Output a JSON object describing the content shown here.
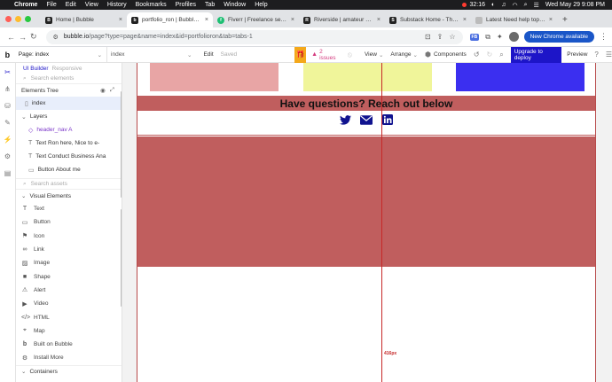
{
  "menubar": {
    "app": "Chrome",
    "items": [
      "File",
      "Edit",
      "View",
      "History",
      "Bookmarks",
      "Profiles",
      "Tab",
      "Window",
      "Help"
    ],
    "timer": "32:16",
    "datetime": "Wed May 29  9:08 PM"
  },
  "tabs": [
    {
      "title": "Home | Bubble",
      "favicon": "B",
      "color": "#222"
    },
    {
      "title": "portfolio_ron | Bubble Editor",
      "favicon": "b",
      "color": "#222"
    },
    {
      "title": "Fiverr | Freelance services",
      "favicon": "f",
      "color": "#1dbf73"
    },
    {
      "title": "Riverside | amateur builder",
      "favicon": "R",
      "color": "#222"
    },
    {
      "title": "Substack Home - The Bubble",
      "favicon": "S",
      "color": "#222"
    },
    {
      "title": "Latest Need help topics",
      "favicon": "",
      "color": "#888"
    }
  ],
  "address": {
    "url_host": "bubble.io",
    "url_path": "/page?type=page&name=index&id=portfolioron&tab=tabs-1",
    "ext_badge": "FB",
    "new_chrome": "New Chrome available"
  },
  "toolbar": {
    "page_label": "Page: index",
    "page_value": "index",
    "edit": "Edit",
    "saved": "Saved",
    "issues": "2 issues",
    "view": "View",
    "arrange": "Arrange",
    "components": "Components",
    "upgrade": "Upgrade to deploy",
    "preview": "Preview"
  },
  "panel": {
    "tab_active": "UI Builder",
    "tab_inactive": "Responsive",
    "search_placeholder": "Search elements",
    "tree_title": "Elements Tree",
    "tree": [
      {
        "label": "index",
        "selected": true
      },
      {
        "label": "Layers",
        "selected": false
      },
      {
        "label": "header_nav A",
        "selected": false
      },
      {
        "label": "Text Ron here, Nice to e-",
        "selected": false
      },
      {
        "label": "Text Conduct Business Ana",
        "selected": false
      },
      {
        "label": "Button About me",
        "selected": false
      }
    ],
    "assets_placeholder": "Search assets",
    "visual_title": "Visual Elements",
    "visual_elements": [
      {
        "label": "Text",
        "icon": "text-icon"
      },
      {
        "label": "Button",
        "icon": "button-icon"
      },
      {
        "label": "Icon",
        "icon": "flag-icon"
      },
      {
        "label": "Link",
        "icon": "link-icon"
      },
      {
        "label": "Image",
        "icon": "image-icon"
      },
      {
        "label": "Shape",
        "icon": "square-icon"
      },
      {
        "label": "Alert",
        "icon": "alert-icon"
      },
      {
        "label": "Video",
        "icon": "video-icon"
      },
      {
        "label": "HTML",
        "icon": "code-icon"
      },
      {
        "label": "Map",
        "icon": "map-icon"
      },
      {
        "label": "Built on Bubble",
        "icon": "bubble-icon"
      },
      {
        "label": "Install More",
        "icon": "plugin-icon"
      }
    ],
    "containers_title": "Containers"
  },
  "canvas": {
    "heading": "Have questions? Reach out below",
    "measure": "416px",
    "colors": {
      "pink": "#e8a5a5",
      "yellow": "#f0f59a",
      "blue": "#3b2ff0",
      "red_block": "#c05e5e",
      "social": "#10138f"
    }
  }
}
